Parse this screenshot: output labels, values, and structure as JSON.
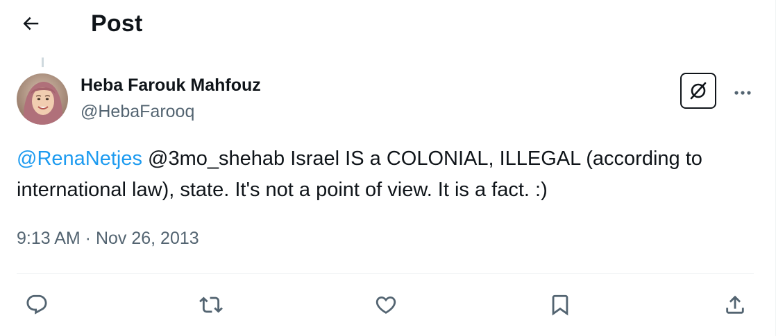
{
  "header": {
    "title": "Post",
    "back_icon": "arrow-left-icon"
  },
  "post": {
    "author": {
      "name": "Heba Farouk Mahfouz",
      "handle": "@HebaFarooq"
    },
    "text": {
      "mention_1": "@RenaNetjes",
      "body": " @3mo_shehab Israel IS a COLONIAL, ILLEGAL (according to international law), state. It's not a point of view. It is a fact. :)"
    },
    "time": "9:13 AM",
    "separator": " · ",
    "date": "Nov 26, 2013"
  },
  "actions": [
    {
      "name": "reply",
      "icon": "reply-icon"
    },
    {
      "name": "repost",
      "icon": "repost-icon"
    },
    {
      "name": "like",
      "icon": "heart-icon"
    },
    {
      "name": "bookmark",
      "icon": "bookmark-icon"
    },
    {
      "name": "share",
      "icon": "share-icon"
    }
  ],
  "colors": {
    "text_primary": "#0f1419",
    "text_secondary": "#536471",
    "link": "#1d9bf0",
    "divider": "#eff3f4"
  }
}
